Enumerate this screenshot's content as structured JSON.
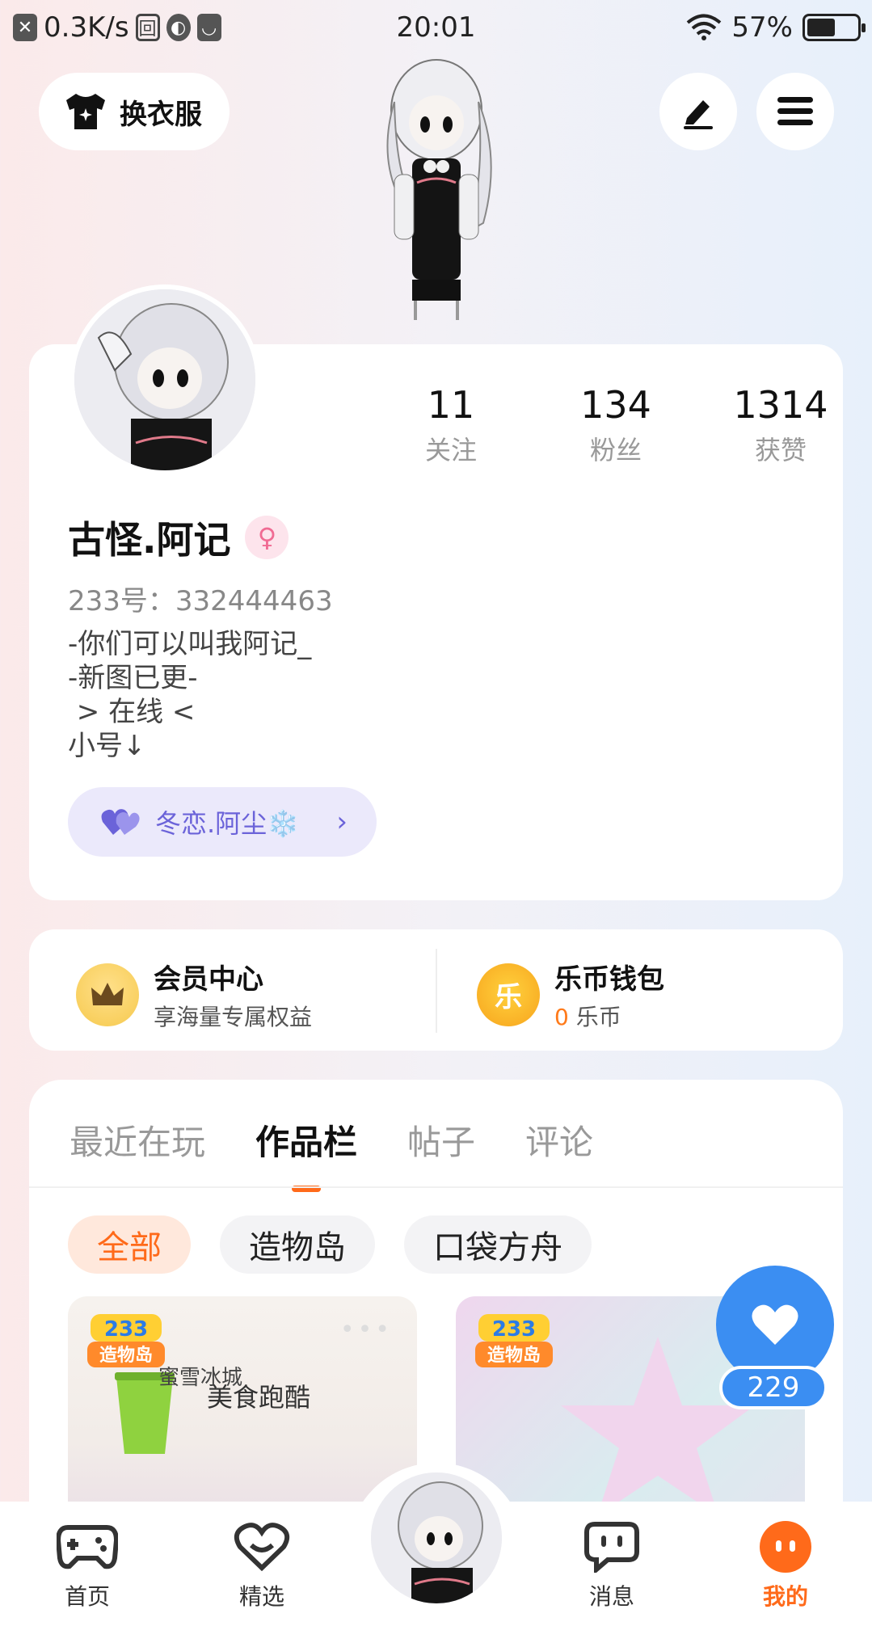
{
  "status_bar": {
    "speed": "0.3K/s",
    "time": "20:01",
    "battery": "57%"
  },
  "top": {
    "dress_label": "换衣服"
  },
  "profile": {
    "stats": [
      {
        "value": "11",
        "label": "关注"
      },
      {
        "value": "134",
        "label": "粉丝"
      },
      {
        "value": "1314",
        "label": "获赞"
      }
    ],
    "username": "古怪.阿记",
    "uid": "233号：332444463",
    "bio": [
      "-你们可以叫我阿记_",
      "-新图已更-",
      " > 在线 <",
      "小号↓"
    ],
    "cp_name": "冬恋.阿尘❄️"
  },
  "member": {
    "vip_title": "会员中心",
    "vip_sub": "享海量专属权益",
    "wallet_title": "乐币钱包",
    "wallet_amount": "0",
    "wallet_unit": " 乐币",
    "coin_char": "乐"
  },
  "works": {
    "tabs": [
      "最近在玩",
      "作品栏",
      "帖子",
      "评论"
    ],
    "filters": [
      "全部",
      "造物岛",
      "口袋方舟"
    ],
    "tiles": [
      {
        "badge": "233",
        "badge2": "造物岛",
        "text": "美食跑酷",
        "sub": "蜜雪冰城"
      },
      {
        "badge": "233",
        "badge2": "造物岛"
      }
    ]
  },
  "like_count": "229",
  "nav": [
    "首页",
    "精选",
    "消息",
    "我的"
  ],
  "colors": {
    "accent": "#ff6a1a",
    "like_blue": "#3b8ef2",
    "cp_purple": "#6b63d9"
  }
}
